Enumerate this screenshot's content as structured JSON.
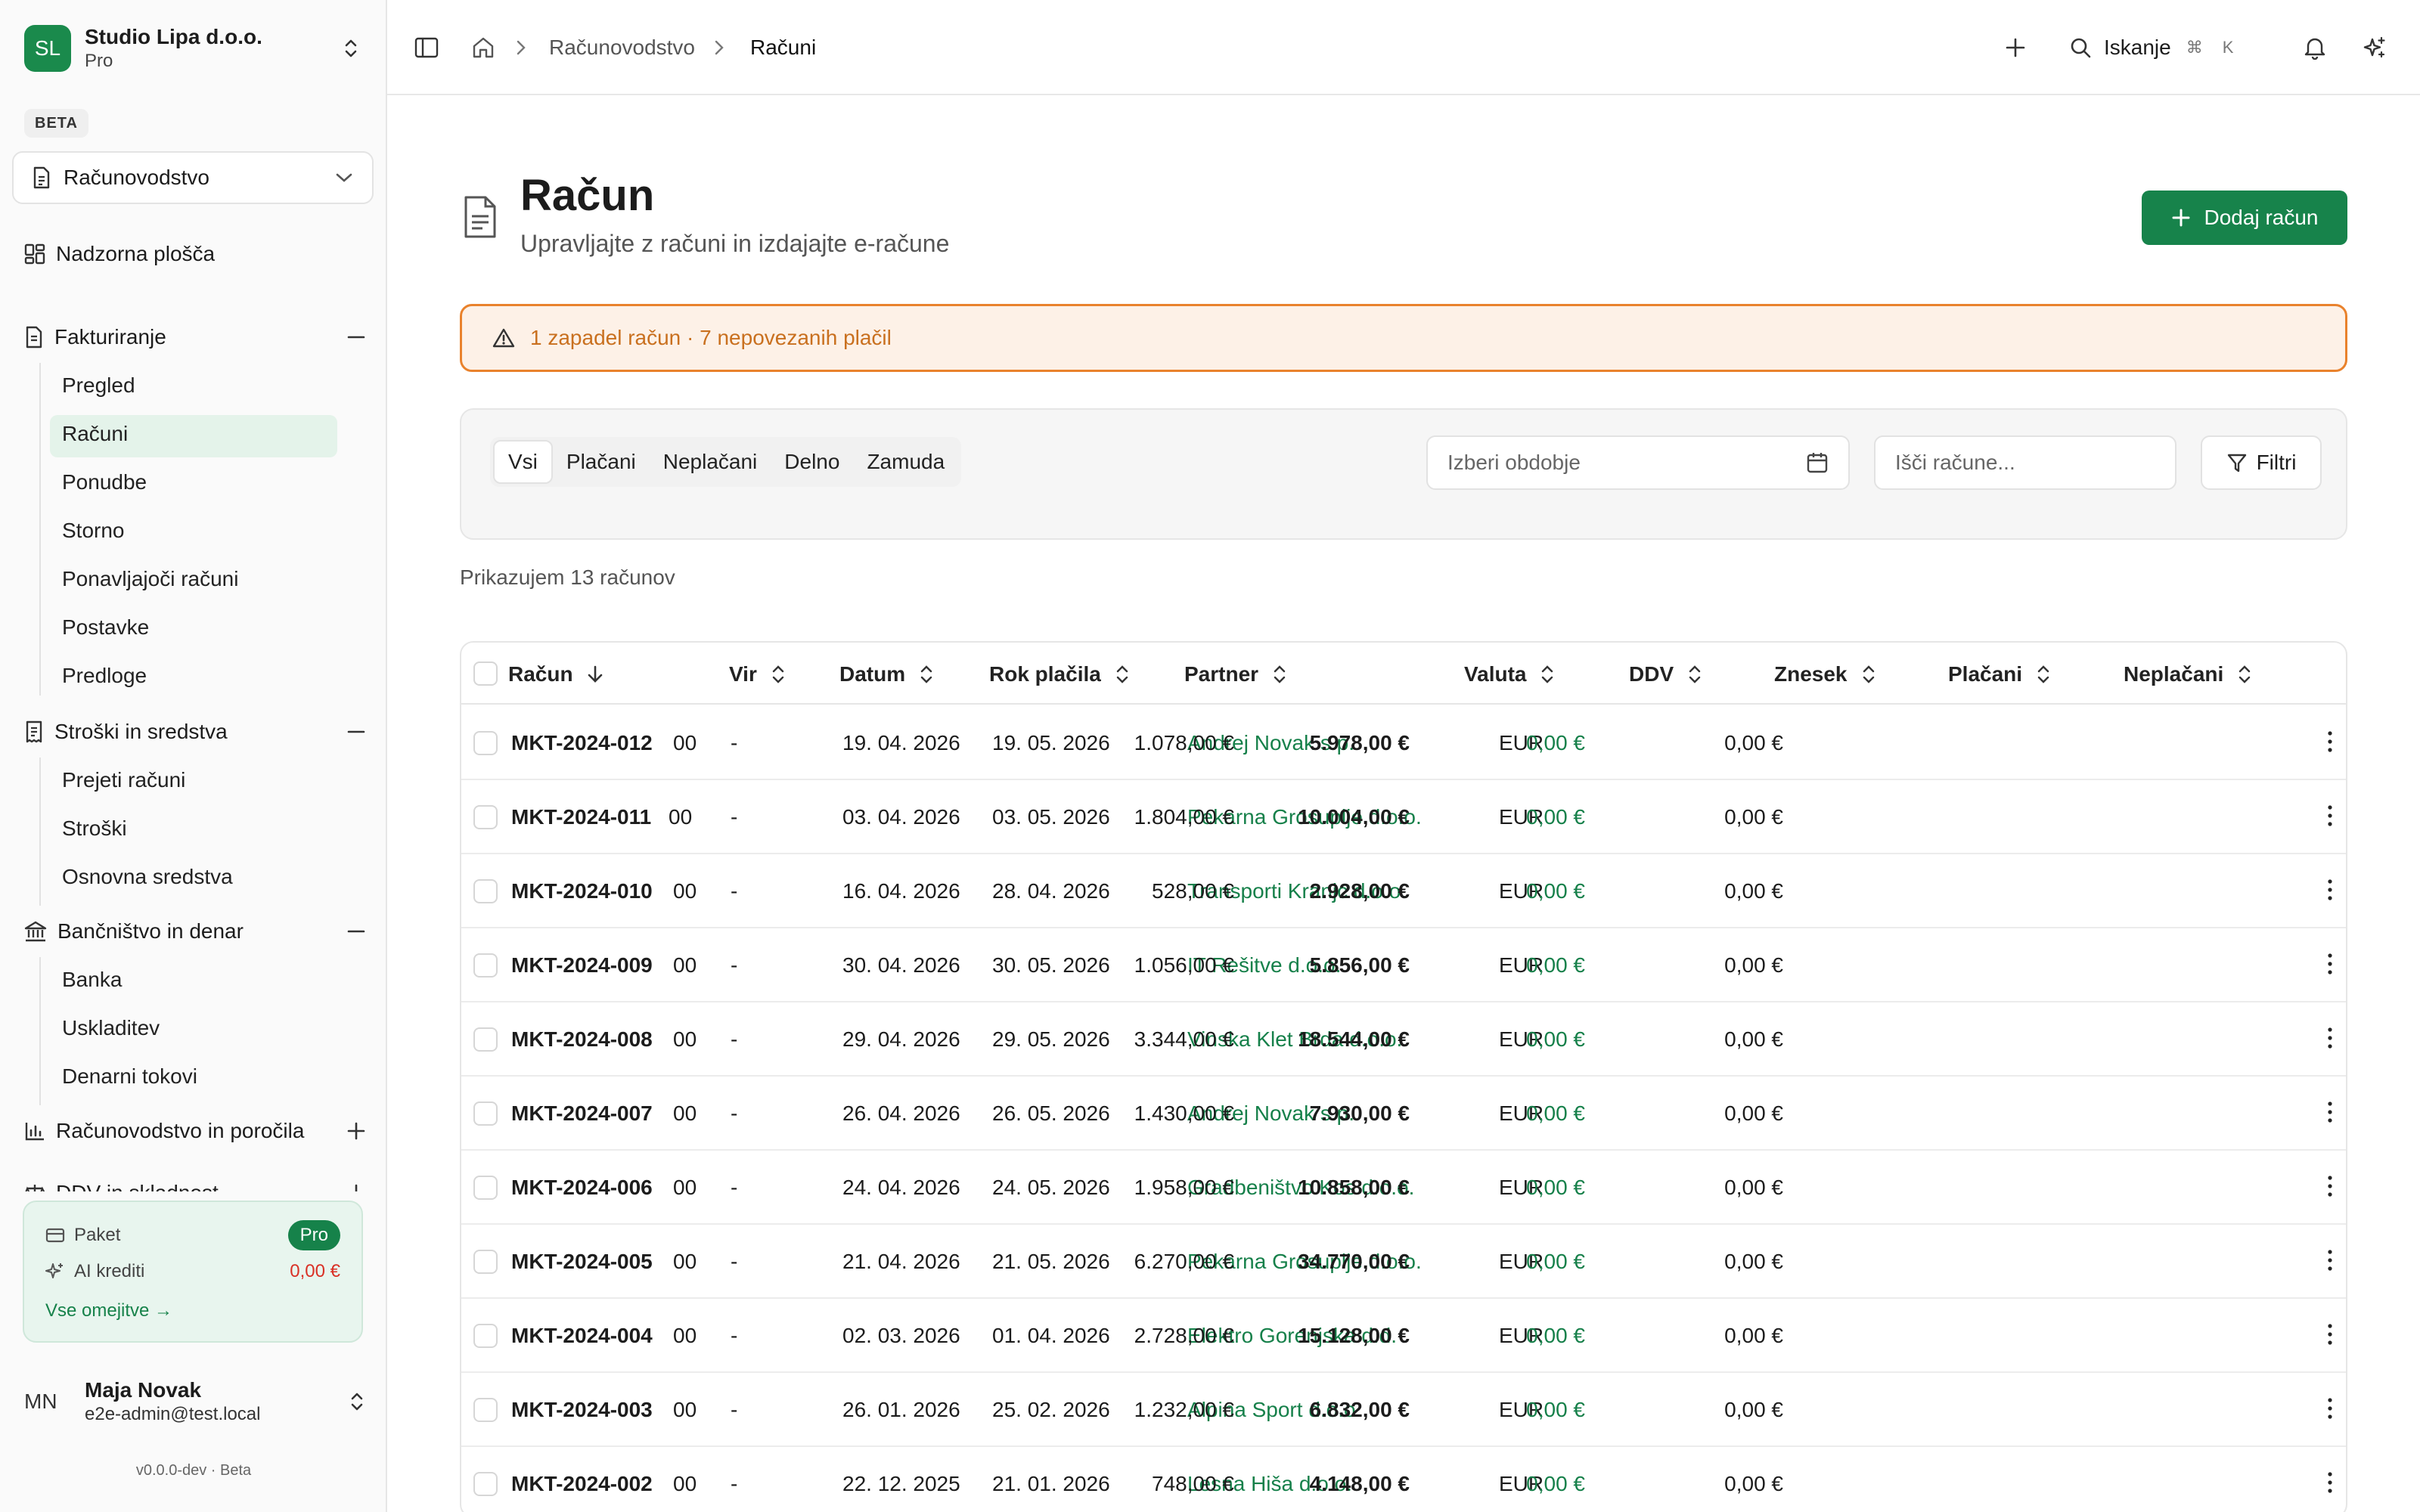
{
  "org": {
    "initials": "SL",
    "name": "Studio Lipa d.o.o.",
    "plan": "Pro"
  },
  "beta": "BETA",
  "module": "Računovodstvo",
  "nav": {
    "dashboard": "Nadzorna plošča",
    "groups": [
      {
        "label": "Fakturiranje",
        "expanded": true,
        "items": [
          "Pregled",
          "Računi",
          "Ponudbe",
          "Storno",
          "Ponavljajoči računi",
          "Postavke",
          "Predloge"
        ]
      },
      {
        "label": "Stroški in sredstva",
        "expanded": true,
        "items": [
          "Prejeti računi",
          "Stroški",
          "Osnovna sredstva"
        ]
      },
      {
        "label": "Bančništvo in denar",
        "expanded": true,
        "items": [
          "Banka",
          "Uskladitev",
          "Denarni tokovi"
        ]
      },
      {
        "label": "Računovodstvo in poročila",
        "expanded": false,
        "items": []
      },
      {
        "label": "DDV in skladnost",
        "expanded": false,
        "items": []
      }
    ],
    "active": "Računi"
  },
  "quota": {
    "plan_label": "Paket",
    "plan_value": "Pro",
    "credits_label": "AI krediti",
    "credits_value": "0,00 €",
    "link": "Vse omejitve →"
  },
  "user": {
    "initials": "MN",
    "name": "Maja Novak",
    "email": "e2e-admin@test.local"
  },
  "version": "v0.0.0-dev · Beta",
  "topbar": {
    "breadcrumbs": [
      "Računovodstvo",
      "Računi"
    ],
    "search_label": "Iskanje",
    "shortcut_cmd": "⌘",
    "shortcut_key": "K"
  },
  "page": {
    "title": "Račun",
    "subtitle": "Upravljajte z računi in izdajajte e-račune",
    "add_button": "Dodaj račun"
  },
  "alert": "1 zapadel račun · 7 nepovezanih plačil",
  "filters": {
    "tabs": [
      "Vsi",
      "Plačani",
      "Neplačani",
      "Delno",
      "Zamuda"
    ],
    "active_tab": "Vsi",
    "period_placeholder": "Izberi obdobje",
    "search_placeholder": "Išči račune...",
    "filter_button": "Filtri"
  },
  "count_text": "Prikazujem 13 računov",
  "table": {
    "columns": [
      "Račun",
      "Vir",
      "Datum",
      "Rok plačila",
      "Partner",
      "Valuta",
      "DDV",
      "Znesek",
      "Plačani",
      "Neplačani"
    ],
    "rows": [
      {
        "id": "MKT-2024-012",
        "suffix": "00",
        "vir": "-",
        "datum": "19. 04. 2026",
        "rok": "19. 05. 2026",
        "partner": "Andrej Novak s.p.",
        "valuta": "EUR",
        "ddv": "1.078,00 €",
        "znesek": "5.978,00 €",
        "placani": "0,00 €",
        "neplacani": "0,00 €"
      },
      {
        "id": "MKT-2024-011",
        "suffix": "00",
        "vir": "-",
        "datum": "03. 04. 2026",
        "rok": "03. 05. 2026",
        "partner": "Pekarna Grosuplje d.o.o.",
        "valuta": "EUR",
        "ddv": "1.804,00 €",
        "znesek": "10.004,00 €",
        "placani": "0,00 €",
        "neplacani": "0,00 €"
      },
      {
        "id": "MKT-2024-010",
        "suffix": "00",
        "vir": "-",
        "datum": "16. 04. 2026",
        "rok": "28. 04. 2026",
        "partner": "Transporti Kranjc d.o.o.",
        "valuta": "EUR",
        "ddv": "528,00 €",
        "znesek": "2.928,00 €",
        "placani": "0,00 €",
        "neplacani": "0,00 €"
      },
      {
        "id": "MKT-2024-009",
        "suffix": "00",
        "vir": "-",
        "datum": "30. 04. 2026",
        "rok": "30. 05. 2026",
        "partner": "IT Rešitve d.o.o.",
        "valuta": "EUR",
        "ddv": "1.056,00 €",
        "znesek": "5.856,00 €",
        "placani": "0,00 €",
        "neplacani": "0,00 €"
      },
      {
        "id": "MKT-2024-008",
        "suffix": "00",
        "vir": "-",
        "datum": "29. 04. 2026",
        "rok": "29. 05. 2026",
        "partner": "Vinska Klet Brda d.o.o.",
        "valuta": "EUR",
        "ddv": "3.344,00 €",
        "znesek": "18.544,00 €",
        "placani": "0,00 €",
        "neplacani": "0,00 €"
      },
      {
        "id": "MKT-2024-007",
        "suffix": "00",
        "vir": "-",
        "datum": "26. 04. 2026",
        "rok": "26. 05. 2026",
        "partner": "Andrej Novak s.p.",
        "valuta": "EUR",
        "ddv": "1.430,00 €",
        "znesek": "7.930,00 €",
        "placani": "0,00 €",
        "neplacani": "0,00 €"
      },
      {
        "id": "MKT-2024-006",
        "suffix": "00",
        "vir": "-",
        "datum": "24. 04. 2026",
        "rok": "24. 05. 2026",
        "partner": "Gradbeništvo Kos d.o.o.",
        "valuta": "EUR",
        "ddv": "1.958,00 €",
        "znesek": "10.858,00 €",
        "placani": "0,00 €",
        "neplacani": "0,00 €"
      },
      {
        "id": "MKT-2024-005",
        "suffix": "00",
        "vir": "-",
        "datum": "21. 04. 2026",
        "rok": "21. 05. 2026",
        "partner": "Pekarna Grosuplje d.o.o.",
        "valuta": "EUR",
        "ddv": "6.270,00 €",
        "znesek": "34.770,00 €",
        "placani": "0,00 €",
        "neplacani": "0,00 €"
      },
      {
        "id": "MKT-2024-004",
        "suffix": "00",
        "vir": "-",
        "datum": "02. 03. 2026",
        "rok": "01. 04. 2026",
        "partner": "Elektro Gorenjska d.d.",
        "valuta": "EUR",
        "ddv": "2.728,00 €",
        "znesek": "15.128,00 €",
        "placani": "0,00 €",
        "neplacani": "0,00 €"
      },
      {
        "id": "MKT-2024-003",
        "suffix": "00",
        "vir": "-",
        "datum": "26. 01. 2026",
        "rok": "25. 02. 2026",
        "partner": "Alpina Sport d.o.o.",
        "valuta": "EUR",
        "ddv": "1.232,00 €",
        "znesek": "6.832,00 €",
        "placani": "0,00 €",
        "neplacani": "0,00 €"
      },
      {
        "id": "MKT-2024-002",
        "suffix": "00",
        "vir": "-",
        "datum": "22. 12. 2025",
        "rok": "21. 01. 2026",
        "partner": "Lesna Hiša d.o.o.",
        "valuta": "EUR",
        "ddv": "748,00 €",
        "znesek": "4.148,00 €",
        "placani": "0,00 €",
        "neplacani": "0,00 €"
      }
    ]
  },
  "colors": {
    "brand": "#17834b",
    "alert_border": "#e9822c",
    "alert_text": "#c9701f",
    "danger": "#d93025"
  }
}
